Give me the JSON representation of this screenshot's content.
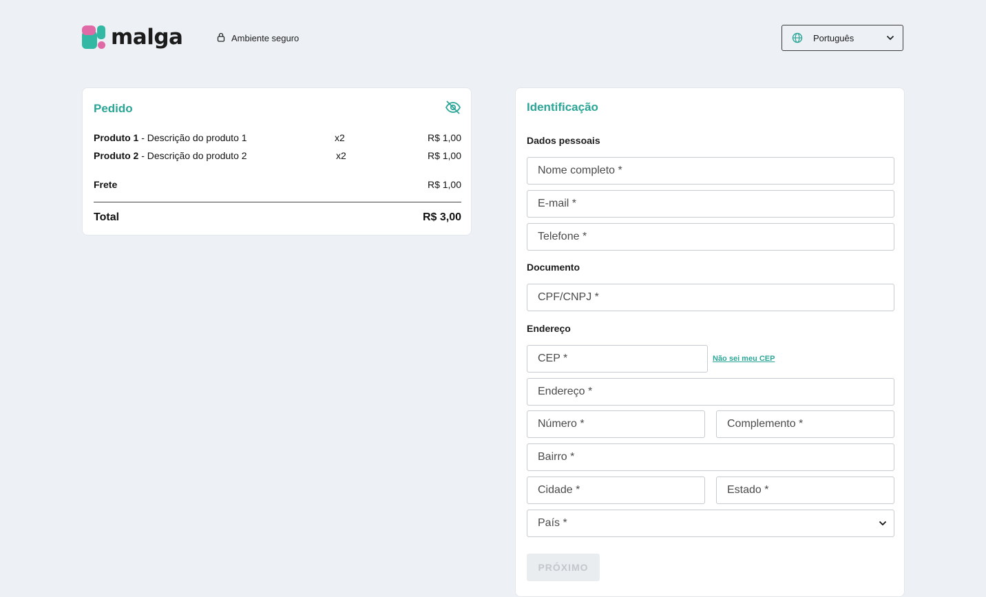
{
  "header": {
    "brand": "malga",
    "secure_label": "Ambiente seguro",
    "language": "Português"
  },
  "order": {
    "title": "Pedido",
    "items": [
      {
        "name": "Produto 1",
        "description": " - Descrição do produto 1",
        "qty": "x2",
        "price": "R$ 1,00"
      },
      {
        "name": "Produto 2",
        "description": " - Descrição do produto 2",
        "qty": "x2",
        "price": "R$ 1,00"
      }
    ],
    "shipping_label": "Frete",
    "shipping_price": "R$ 1,00",
    "total_label": "Total",
    "total_price": "R$ 3,00"
  },
  "identification": {
    "title": "Identificação",
    "personal_label": "Dados pessoais",
    "name_placeholder": "Nome completo *",
    "email_placeholder": "E-mail *",
    "phone_placeholder": "Telefone *",
    "document_label": "Documento",
    "cpf_placeholder": "CPF/CNPJ *",
    "address_label": "Endereço",
    "cep_placeholder": "CEP *",
    "cep_link": "Não sei meu CEP",
    "street_placeholder": "Endereço *",
    "number_placeholder": "Número *",
    "complement_placeholder": "Complemento *",
    "district_placeholder": "Bairro *",
    "city_placeholder": "Cidade *",
    "state_placeholder": "Estado *",
    "country_placeholder": "País *",
    "next_label": "PRÓXIMO"
  },
  "colors": {
    "accent": "#2aa596",
    "background": "#edf1f5",
    "brand_pink": "#e06aa6",
    "brand_teal": "#33b8a4"
  },
  "icons": [
    "lock-icon",
    "globe-icon",
    "chevron-down-icon",
    "eye-off-icon"
  ]
}
